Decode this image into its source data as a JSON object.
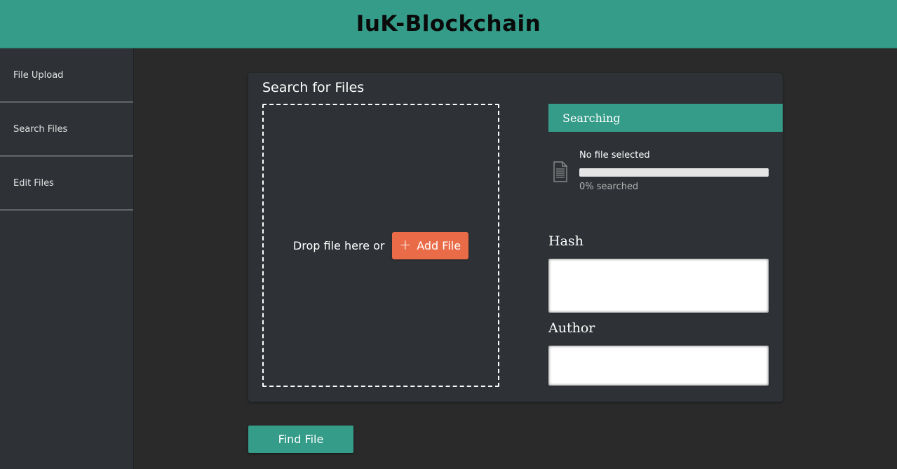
{
  "app": {
    "title": "IuK-Blockchain"
  },
  "colors": {
    "accent": "#359c89",
    "add_button": "#ea6b47",
    "page_background": "#2a2a2a",
    "panel_background": "#2e3236"
  },
  "sidebar": {
    "items": [
      {
        "label": "File Upload"
      },
      {
        "label": "Search Files"
      },
      {
        "label": "Edit Files"
      }
    ]
  },
  "search_panel": {
    "title": "Search for Files",
    "dropzone": {
      "prompt": "Drop file here or",
      "add_button_label": "Add File",
      "add_icon": "plus-icon"
    },
    "status": {
      "header": "Searching",
      "file_icon": "document-icon",
      "file_name": "No file selected",
      "progress": 0,
      "progress_label": "0% searched"
    },
    "fields": {
      "hash": {
        "label": "Hash",
        "value": ""
      },
      "author": {
        "label": "Author",
        "value": ""
      }
    }
  },
  "actions": {
    "find_button_label": "Find File"
  }
}
